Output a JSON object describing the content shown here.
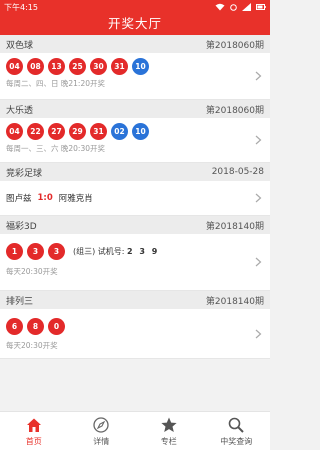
{
  "statusbar": {
    "time": "下午4:15"
  },
  "header": {
    "title": "开奖大厅"
  },
  "cards": [
    {
      "name": "双色球",
      "issue": "第2018060期",
      "red_balls": [
        "04",
        "08",
        "13",
        "25",
        "30",
        "31"
      ],
      "blue_balls": [
        "10"
      ],
      "note": "每周二、四、日 晚21:20开奖"
    },
    {
      "name": "大乐透",
      "issue": "第2018060期",
      "red_balls": [
        "04",
        "22",
        "27",
        "29",
        "31"
      ],
      "blue_balls": [
        "02",
        "10"
      ],
      "note": "每周一、三、六 晚20:30开奖"
    },
    {
      "name": "竞彩足球",
      "issue": "2018-05-28",
      "home": "图卢兹",
      "score": "1:0",
      "away": "阿雅克肖"
    },
    {
      "name": "福彩3D",
      "issue": "第2018140期",
      "red_balls": [
        "1",
        "3",
        "3"
      ],
      "group_label": "(组三)",
      "trial_label": "试机号:",
      "trial_number": "2 3 9",
      "note": "每天20:30开奖"
    },
    {
      "name": "排列三",
      "issue": "第2018140期",
      "red_balls": [
        "6",
        "8",
        "0"
      ],
      "note": "每天20:30开奖"
    }
  ],
  "tabs": [
    {
      "label": "首页",
      "icon": "home-icon",
      "active": true
    },
    {
      "label": "详情",
      "icon": "compass-icon",
      "active": false
    },
    {
      "label": "专栏",
      "icon": "star-icon",
      "active": false
    },
    {
      "label": "中奖查询",
      "icon": "search-icon",
      "active": false
    }
  ],
  "colors": {
    "primary": "#e8312a",
    "red_ball": "#e32a2a",
    "blue_ball": "#2a73d8"
  }
}
